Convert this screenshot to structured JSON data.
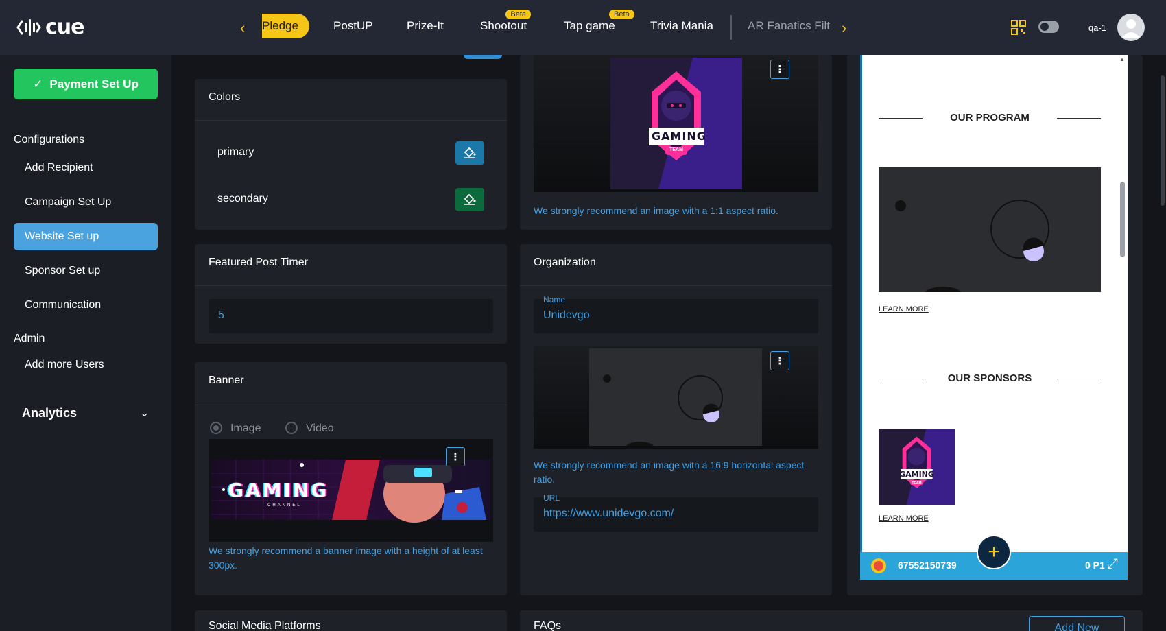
{
  "app": {
    "logo_text": "cue"
  },
  "topnav": {
    "items": [
      {
        "label": "Pledge"
      },
      {
        "label": "PostUP"
      },
      {
        "label": "Prize-It"
      },
      {
        "label": "Shootout",
        "badge": "Beta"
      },
      {
        "label": "Tap game",
        "badge": "Beta"
      },
      {
        "label": "Trivia Mania"
      },
      {
        "label": "AR Fanatics Filt"
      }
    ],
    "user": "qa-1"
  },
  "sidebar": {
    "payment_button": "Payment Set Up",
    "configurations_heading": "Configurations",
    "config_items": [
      "Add Recipient",
      "Campaign Set Up",
      "Website Set up",
      "Sponsor Set up",
      "Communication"
    ],
    "admin_heading": "Admin",
    "admin_items": [
      "Add more Users"
    ],
    "analytics": "Analytics"
  },
  "colors": {
    "title": "Colors",
    "primary_label": "primary",
    "secondary_label": "secondary",
    "primary_hex": "#1b78a8",
    "secondary_hex": "#0d6a3d"
  },
  "featured_timer": {
    "title": "Featured Post Timer",
    "value": "5"
  },
  "banner": {
    "title": "Banner",
    "option_image": "Image",
    "option_video": "Video",
    "banner_text": "GAMING",
    "banner_subtext": "CHANNEL",
    "hint": "We strongly recommend a banner image with a height of at least 300px."
  },
  "logo_card": {
    "logo_text": "GAMING",
    "logo_subtext": "TEAM",
    "hint": "We strongly recommend an image with a 1:1 aspect ratio."
  },
  "organization": {
    "title": "Organization",
    "name_label": "Name",
    "name_value": "Unidevgo",
    "image_hint": "We strongly recommend an image with a 16:9 horizontal aspect ratio.",
    "url_label": "URL",
    "url_value": "https://www.unidevgo.com/"
  },
  "social": {
    "title": "Social Media Platforms"
  },
  "faqs": {
    "title": "FAQs",
    "add_button": "Add New"
  },
  "preview": {
    "our_program": "OUR PROGRAM",
    "our_sponsors": "OUR SPONSORS",
    "learn_more": "LEARN MORE",
    "sponsor_logo_text": "GAMING",
    "sponsor_logo_subtext": "TEAM",
    "footer_phone": "67552150739",
    "footer_points": "0 P1"
  }
}
